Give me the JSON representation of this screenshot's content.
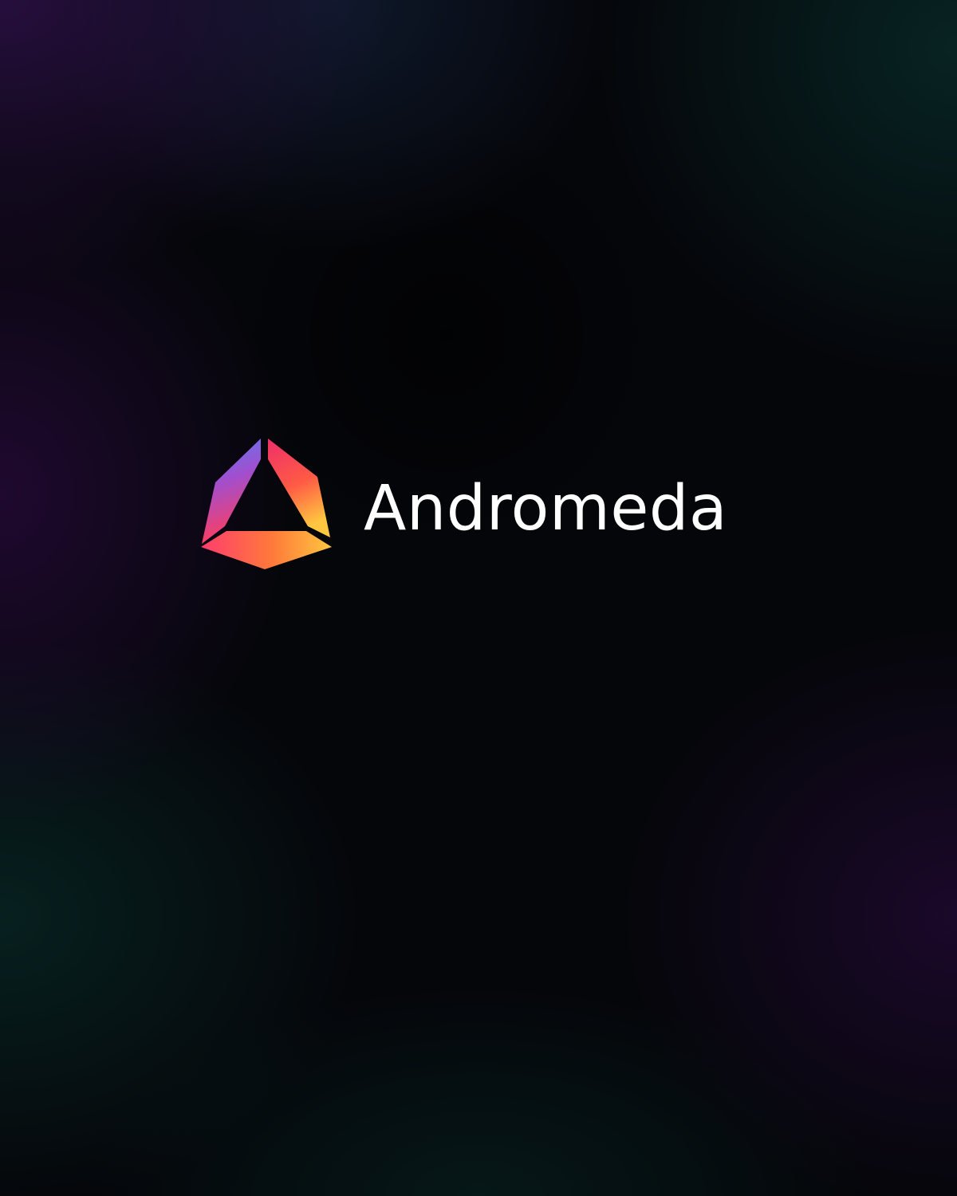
{
  "brand": {
    "name": "Andromeda",
    "logo_icon": "andromeda-triangle-logo-icon",
    "colors": {
      "text": "#ffffff",
      "logo_blue": "#5a7ef0",
      "logo_magenta": "#ee2f6a",
      "logo_orange": "#ff7a3a",
      "logo_yellow": "#ffc640"
    }
  },
  "background": {
    "base": "#05060a",
    "glow_purple": "#2c1046",
    "glow_teal": "#0a3c37"
  }
}
